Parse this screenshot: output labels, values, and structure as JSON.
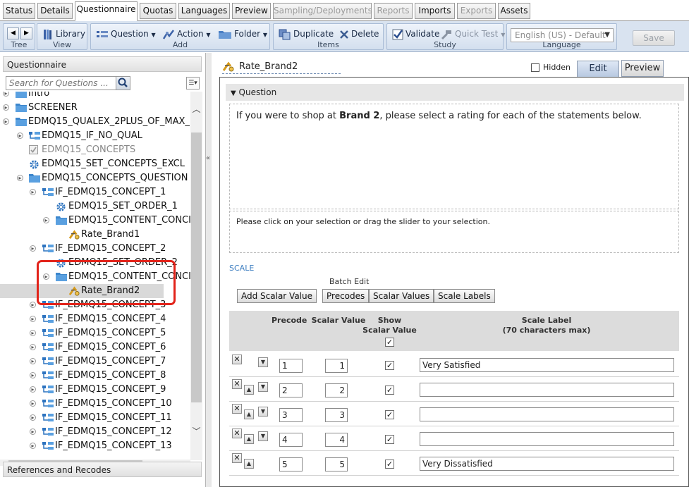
{
  "top_tabs": [
    {
      "label": "Status"
    },
    {
      "label": "Details"
    },
    {
      "label": "Questionnaire"
    },
    {
      "label": "Quotas"
    },
    {
      "label": "Languages"
    },
    {
      "label": "Preview"
    },
    {
      "label": "Sampling/Deployments"
    },
    {
      "label": "Reports"
    },
    {
      "label": "Imports"
    },
    {
      "label": "Exports"
    },
    {
      "label": "Assets"
    }
  ],
  "toolbar": {
    "groups": {
      "tree": "Tree",
      "view": "View",
      "add": "Add",
      "items": "Items",
      "study": "Study",
      "language": "Language"
    },
    "library": "Library",
    "question": "Question",
    "action": "Action",
    "folder": "Folder",
    "duplicate": "Duplicate",
    "delete": "Delete",
    "validate": "Validate",
    "quick_test": "Quick Test",
    "language_value": "English (US) - Default",
    "save": "Save"
  },
  "left": {
    "header": "Questionnaire",
    "search_placeholder": "Search for Questions ...",
    "footer": "References and Recodes",
    "tree": [
      {
        "label": "Intro",
        "icon": "folder-icon"
      },
      {
        "label": "SCREENER",
        "icon": "folder-icon"
      },
      {
        "label": "EDMQ15_QUALEX_2PLUS_OF_MAX_",
        "icon": "folder-icon"
      },
      {
        "label": "EDMQ15_IF_NO_QUAL",
        "icon": "branch-icon"
      },
      {
        "label": "EDMQ15_CONCEPTS",
        "icon": "checkbox-question-icon"
      },
      {
        "label": "EDMQ15_SET_CONCEPTS_EXCL",
        "icon": "gear-icon"
      },
      {
        "label": "EDMQ15_CONCEPTS_QUESTION",
        "icon": "folder-icon"
      },
      {
        "label": "IF_EDMQ15_CONCEPT_1",
        "icon": "branch-icon"
      },
      {
        "label": "EDMQ15_SET_ORDER_1",
        "icon": "gear-icon"
      },
      {
        "label": "EDMQ15_CONTENT_CONCI",
        "icon": "folder-icon"
      },
      {
        "label": "Rate_Brand1",
        "icon": "rating-question-icon"
      },
      {
        "label": "IF_EDMQ15_CONCEPT_2",
        "icon": "branch-icon"
      },
      {
        "label": "EDMQ15_SET_ORDER_2",
        "icon": "gear-icon"
      },
      {
        "label": "EDMQ15_CONTENT_CONCI",
        "icon": "folder-icon"
      },
      {
        "label": "Rate_Brand2",
        "icon": "rating-question-icon"
      },
      {
        "label": "IF_EDMQ15_CONCEPT_3",
        "icon": "branch-icon"
      },
      {
        "label": "IF_EDMQ15_CONCEPT_4",
        "icon": "branch-icon"
      },
      {
        "label": "IF_EDMQ15_CONCEPT_5",
        "icon": "branch-icon"
      },
      {
        "label": "IF_EDMQ15_CONCEPT_6",
        "icon": "branch-icon"
      },
      {
        "label": "IF_EDMQ15_CONCEPT_7",
        "icon": "branch-icon"
      },
      {
        "label": "IF_EDMQ15_CONCEPT_8",
        "icon": "branch-icon"
      },
      {
        "label": "IF_EDMQ15_CONCEPT_9",
        "icon": "branch-icon"
      },
      {
        "label": "IF_EDMQ15_CONCEPT_10",
        "icon": "branch-icon"
      },
      {
        "label": "IF_EDMQ15_CONCEPT_11",
        "icon": "branch-icon"
      },
      {
        "label": "IF_EDMQ15_CONCEPT_12",
        "icon": "branch-icon"
      },
      {
        "label": "IF_EDMQ15_CONCEPT_13",
        "icon": "branch-icon"
      }
    ]
  },
  "editor": {
    "question_name": "Rate_Brand2",
    "hidden_label": "Hidden",
    "tab_edit": "Edit",
    "tab_preview": "Preview",
    "section_title": "Question",
    "question_text_pre": "If you were to shop at ",
    "question_text_bold": "Brand 2",
    "question_text_post": ", please select a rating for each of the statements below.",
    "instruction": "Please click on your selection or drag the slider to your selection.",
    "scale_label": "SCALE",
    "batch_edit": "Batch Edit",
    "add_scalar": "Add Scalar Value",
    "btn_precodes": "Precodes",
    "btn_scalar_values": "Scalar Values",
    "btn_scale_labels": "Scale Labels",
    "col_precode": "Precode",
    "col_scalar": "Scalar Value",
    "col_show_1": "Show",
    "col_show_2": "Scalar Value",
    "col_label_1": "Scale Label",
    "col_label_2": "(70 characters max)",
    "rows": [
      {
        "precode": "1",
        "scalar": "1",
        "label": "Very Satisfied"
      },
      {
        "precode": "2",
        "scalar": "2",
        "label": ""
      },
      {
        "precode": "3",
        "scalar": "3",
        "label": ""
      },
      {
        "precode": "4",
        "scalar": "4",
        "label": ""
      },
      {
        "precode": "5",
        "scalar": "5",
        "label": "Very Dissatisfied"
      }
    ]
  }
}
